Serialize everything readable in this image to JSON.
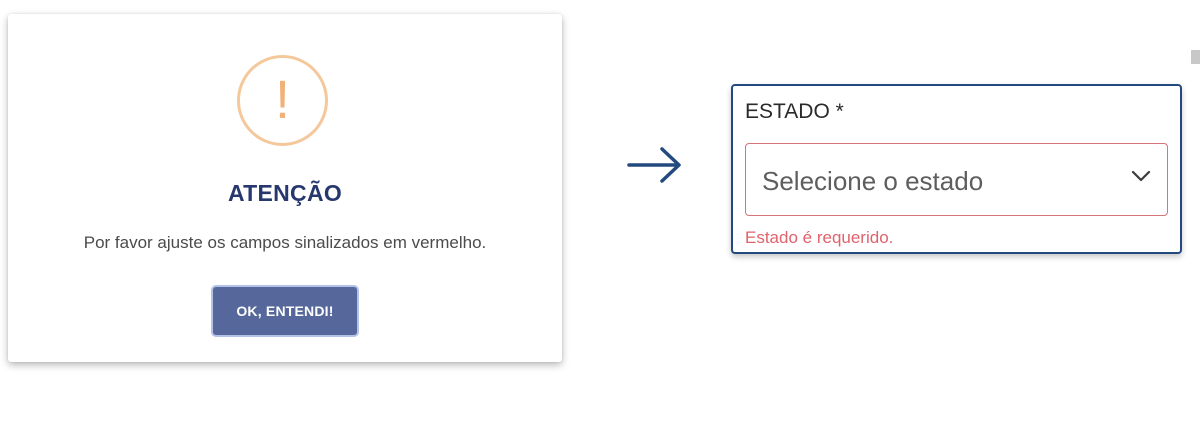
{
  "alert": {
    "icon": "exclamation-icon",
    "icon_glyph": "!",
    "title": "ATENÇÃO",
    "message": "Por favor ajuste os campos sinalizados em vermelho.",
    "button_label": "OK, ENTENDI!"
  },
  "arrow": {
    "icon": "arrow-right-icon"
  },
  "form": {
    "state_field": {
      "label": "ESTADO *",
      "placeholder": "Selecione o estado",
      "error": "Estado é requerido."
    }
  },
  "colors": {
    "title": "#27386f",
    "button": "#56689b",
    "warning": "#f1b27a",
    "error": "#e0636c",
    "field_border": "#234a7f"
  }
}
